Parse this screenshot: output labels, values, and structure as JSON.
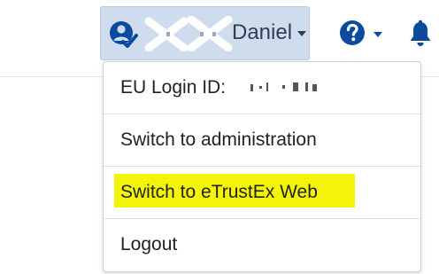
{
  "header": {
    "user": {
      "name": "Daniel",
      "icon": "user-check-icon",
      "redacted": true
    },
    "help": {
      "icon": "question-circle-icon"
    },
    "notifications": {
      "icon": "bell-icon"
    }
  },
  "menu": {
    "items": [
      {
        "label": "EU Login ID:",
        "value_redacted": true
      },
      {
        "label": "Switch to administration"
      },
      {
        "label": "Switch to eTrustEx Web",
        "highlighted": true
      },
      {
        "label": "Logout"
      }
    ]
  },
  "colors": {
    "user_button_bg": "#cfdcee",
    "icon_blue": "#0b4a9c",
    "highlight": "#f4f40a",
    "text": "#222222"
  }
}
